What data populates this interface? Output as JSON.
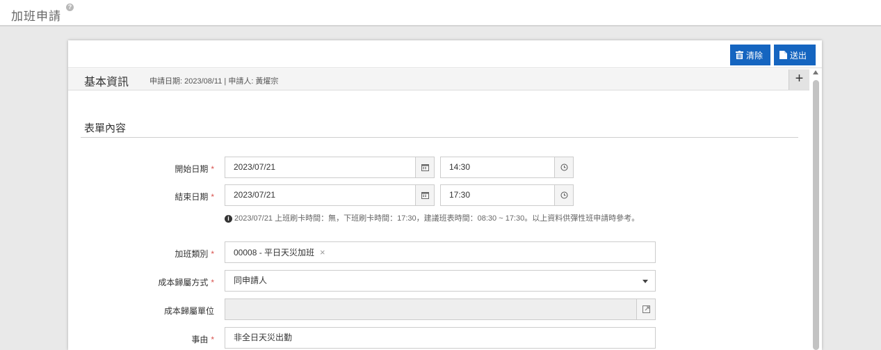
{
  "header": {
    "title": "加班申請",
    "help_icon": "help-circle-icon"
  },
  "toolbar": {
    "clear_label": "清除",
    "send_label": "送出",
    "accent": "#1565c0"
  },
  "section": {
    "title": "基本資訊",
    "meta": "申請日期: 2023/08/11 | 申請人: 黃燿宗",
    "expand_symbol": "+"
  },
  "form": {
    "title": "表單內容",
    "required_mark": "*",
    "start_label": "開始日期",
    "start_date": "2023/07/21",
    "start_time": "14:30",
    "end_label": "結束日期",
    "end_date": "2023/07/21",
    "end_time": "17:30",
    "hint_icon": "i",
    "hint": "2023/07/21 上班刷卡時間：無，下班刷卡時間：17:30，建議班表時間：08:30 ~ 17:30。以上資料供彈性班申請時參考。",
    "type_label": "加班類別",
    "type_value": "00008 - 平日天災加班",
    "type_remove": "×",
    "cost_method_label": "成本歸屬方式",
    "cost_method_value": "同申請人",
    "cost_unit_label": "成本歸屬單位",
    "cost_unit_value": "",
    "reason_label": "事由",
    "reason_value": "非全日天災出勤"
  }
}
